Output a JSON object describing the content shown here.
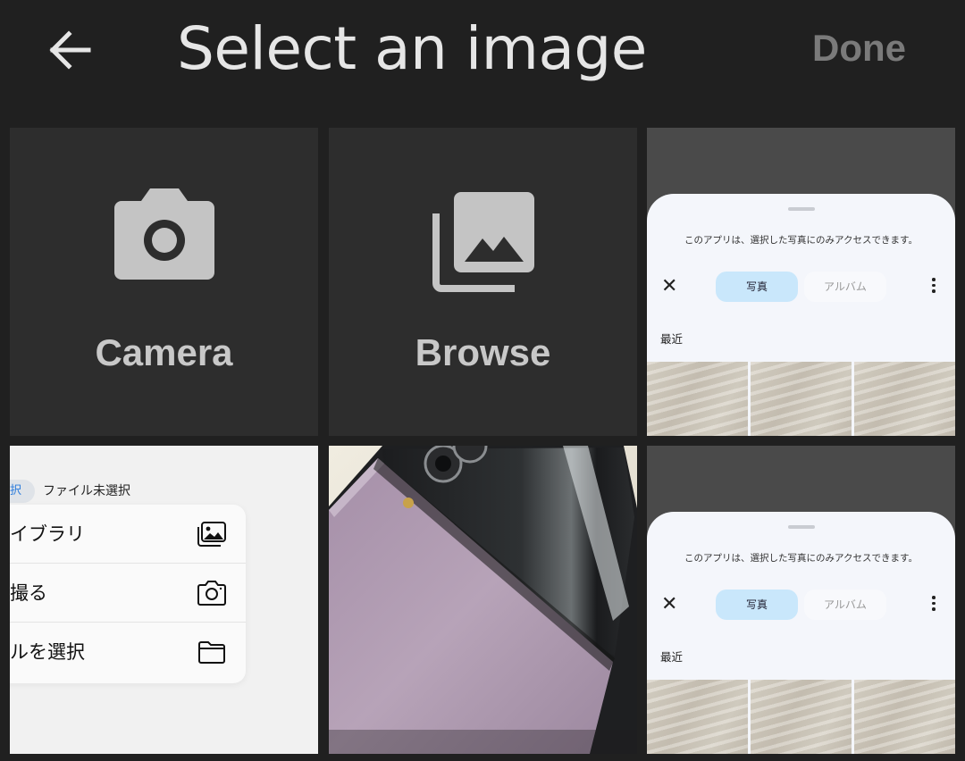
{
  "appbar": {
    "back_icon": "arrow-left-icon",
    "title": "Select an image",
    "done_label": "Done"
  },
  "actions": {
    "camera": {
      "label": "Camera",
      "icon": "camera-icon"
    },
    "browse": {
      "label": "Browse",
      "icon": "photo-library-icon"
    }
  },
  "picker_thumb": {
    "message": "このアプリは、選択した写真にのみアクセスできます。",
    "close_icon": "close-icon",
    "tab_photos": "写真",
    "tab_albums": "アルバム",
    "more_icon": "more-vert-icon",
    "recent_label": "最近"
  },
  "ios_thumb": {
    "choose_chip": "択",
    "no_file": "ファイル未選択",
    "items": [
      {
        "label": "イブラリ",
        "icon": "photo-library-icon"
      },
      {
        "label": "撮る",
        "icon": "camera-icon"
      },
      {
        "label": "ルを選択",
        "icon": "folder-icon"
      }
    ]
  },
  "colors": {
    "background": "#202020",
    "tile": "#2d2d2d",
    "title_text": "#e6e6e6",
    "done_disabled": "#7a7a7a",
    "action_icon": "#c4c4c4",
    "tab_selected": "#c9e7fb"
  }
}
